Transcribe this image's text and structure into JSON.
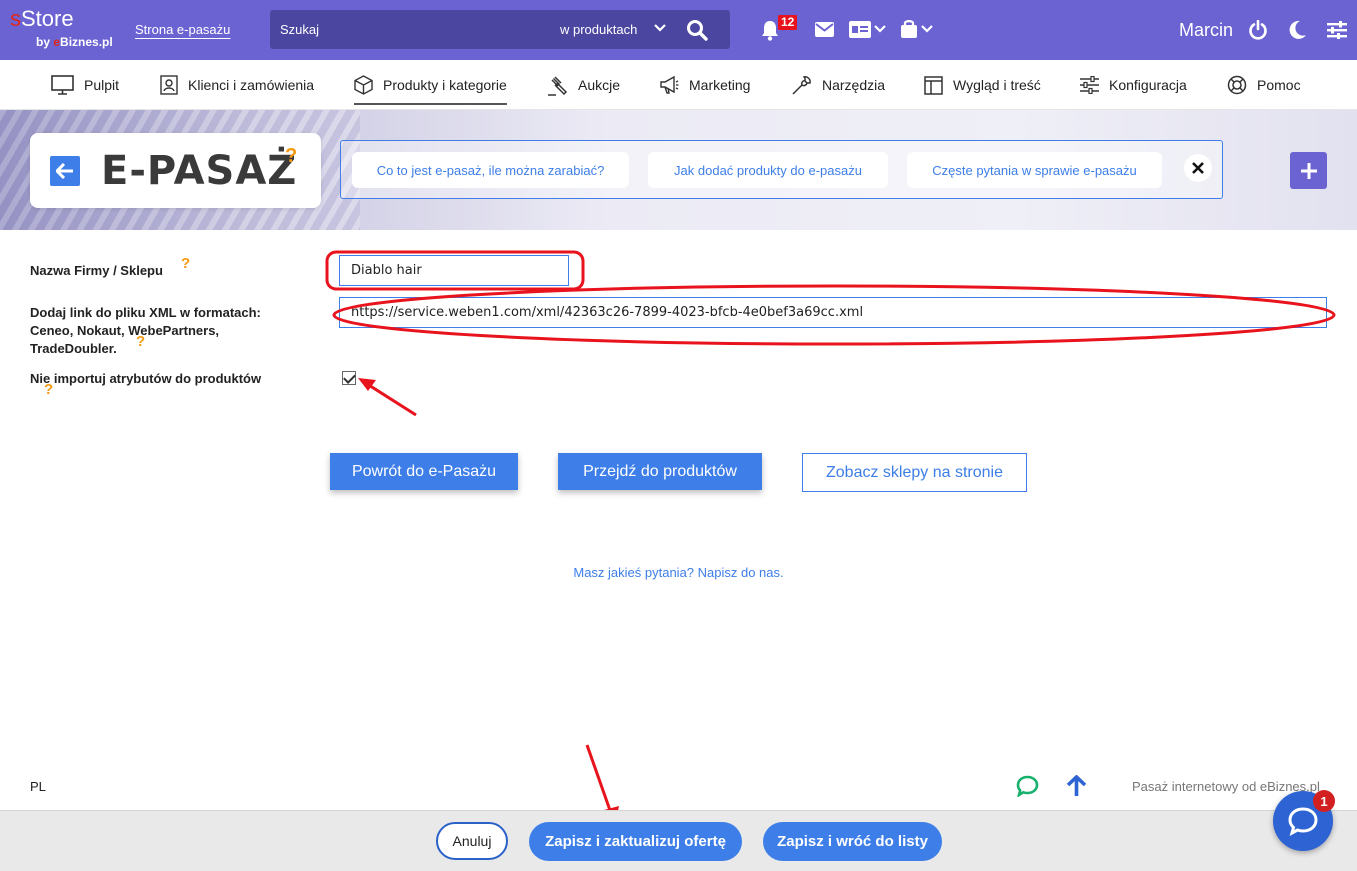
{
  "header": {
    "logo_s": "s",
    "logo_rest": "Store",
    "logo_by": "by ",
    "logo_e": "e",
    "logo_biznes": "Biznes.pl",
    "store_link": "Strona e-pasażu",
    "search_placeholder": "Szukaj",
    "search_scope": "w produktach",
    "notification_count": "12",
    "user_name": "Marcin",
    "bar_color": "#6c63d3"
  },
  "nav": {
    "items": [
      {
        "label": "Pulpit",
        "icon": "monitor-icon"
      },
      {
        "label": "Klienci i zamówienia",
        "icon": "contact-card-icon"
      },
      {
        "label": "Produkty i kategorie",
        "icon": "box-icon"
      },
      {
        "label": "Aukcje",
        "icon": "gavel-icon"
      },
      {
        "label": "Marketing",
        "icon": "megaphone-icon"
      },
      {
        "label": "Narzędzia",
        "icon": "wrench-icon"
      },
      {
        "label": "Wygląd i treść",
        "icon": "layout-icon"
      },
      {
        "label": "Konfiguracja",
        "icon": "sliders-icon"
      },
      {
        "label": "Pomoc",
        "icon": "lifebuoy-icon"
      }
    ],
    "active": "Produkty i kategorie"
  },
  "banner": {
    "title": "E-PASAŻ",
    "help_mark": "?",
    "help_links": [
      "Co to jest e-pasaż, ile można zarabiać?",
      "Jak dodać produkty do e-pasażu",
      "Częste pytania w sprawie e-pasażu"
    ]
  },
  "form": {
    "name_label": "Nazwa Firmy / Sklepu",
    "name_value": "Diablo hair",
    "xml_label_1": "Dodaj link do pliku XML w formatach:",
    "xml_label_2": "Ceneo, Nokaut, WebePartners,",
    "xml_label_3": "TradeDoubler.",
    "xml_value": "https://service.weben1.com/xml/42363c26-7899-4023-bfcb-4e0bef3a69cc.xml",
    "attr_label": "Nie importuj atrybutów do produktów",
    "attr_checked": true,
    "help_mark": "?"
  },
  "buttons": {
    "back": "Powrót do e-Pasażu",
    "products": "Przejdź do produktów",
    "shops": "Zobacz sklepy na stronie"
  },
  "contact_link": "Masz jakieś pytania? Napisz do nas.",
  "footer": {
    "lang": "PL",
    "credit": "Pasaż internetowy od eBiznes.pl"
  },
  "action_bar": {
    "cancel": "Anuluj",
    "save_update": "Zapisz i zaktualizuj ofertę",
    "save_back": "Zapisz i wróć do listy"
  },
  "chat": {
    "badge": "1"
  },
  "colors": {
    "accent": "#3d7ee8",
    "brand": "#6c63d3",
    "annotation": "#e8131c",
    "help": "#f59a13"
  }
}
